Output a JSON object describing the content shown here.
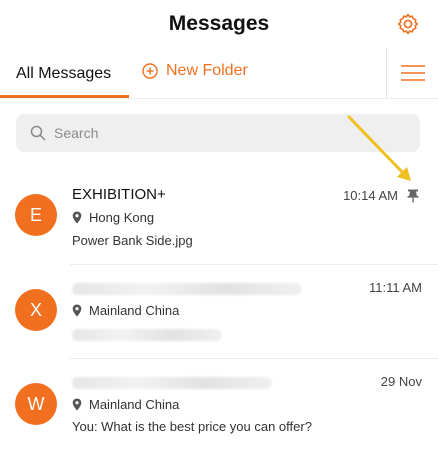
{
  "header": {
    "title": "Messages",
    "settings_icon": "gear-icon"
  },
  "tabs": {
    "all_messages": "All Messages",
    "new_folder": "New Folder",
    "menu_icon": "hamburger-menu-icon"
  },
  "search": {
    "placeholder": "Search"
  },
  "conversations": [
    {
      "avatar_letter": "E",
      "name": "EXHIBITION+",
      "location": "Hong Kong",
      "last_message": "Power Bank Side.jpg",
      "time": "10:14 AM",
      "pinned": true
    },
    {
      "avatar_letter": "X",
      "name": "",
      "location": "Mainland China",
      "last_message": "",
      "time": "11:11 AM",
      "pinned": false
    },
    {
      "avatar_letter": "W",
      "name": "",
      "location": "Mainland China",
      "last_message": "You: What is the best price you can offer?",
      "time": "29 Nov",
      "pinned": false
    }
  ],
  "colors": {
    "accent": "#f07020",
    "annotation_arrow": "#f0c020"
  }
}
